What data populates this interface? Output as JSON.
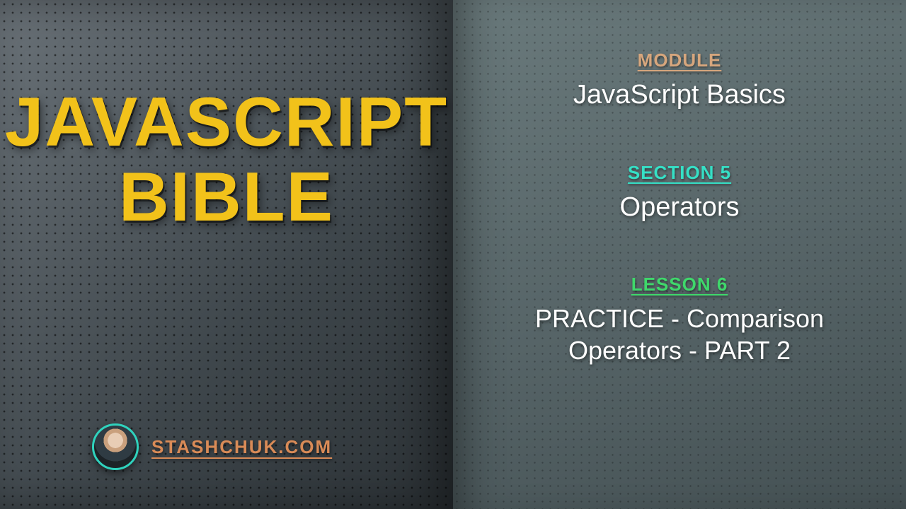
{
  "left": {
    "title_line1": "JAVASCRIPT",
    "title_line2": "BIBLE",
    "site": "STASHCHUK.COM"
  },
  "right": {
    "module": {
      "label": "MODULE",
      "value": "JavaScript Basics"
    },
    "section": {
      "label": "SECTION 5",
      "value": "Operators"
    },
    "lesson": {
      "label": "LESSON 6",
      "value": "PRACTICE - Comparison Operators - PART 2"
    }
  },
  "colors": {
    "title": "#f2c21a",
    "module_label": "#d6a67d",
    "section_label": "#35e0c6",
    "lesson_label": "#3fd86b",
    "site": "#d98b57",
    "avatar_ring": "#2fd2bd"
  }
}
